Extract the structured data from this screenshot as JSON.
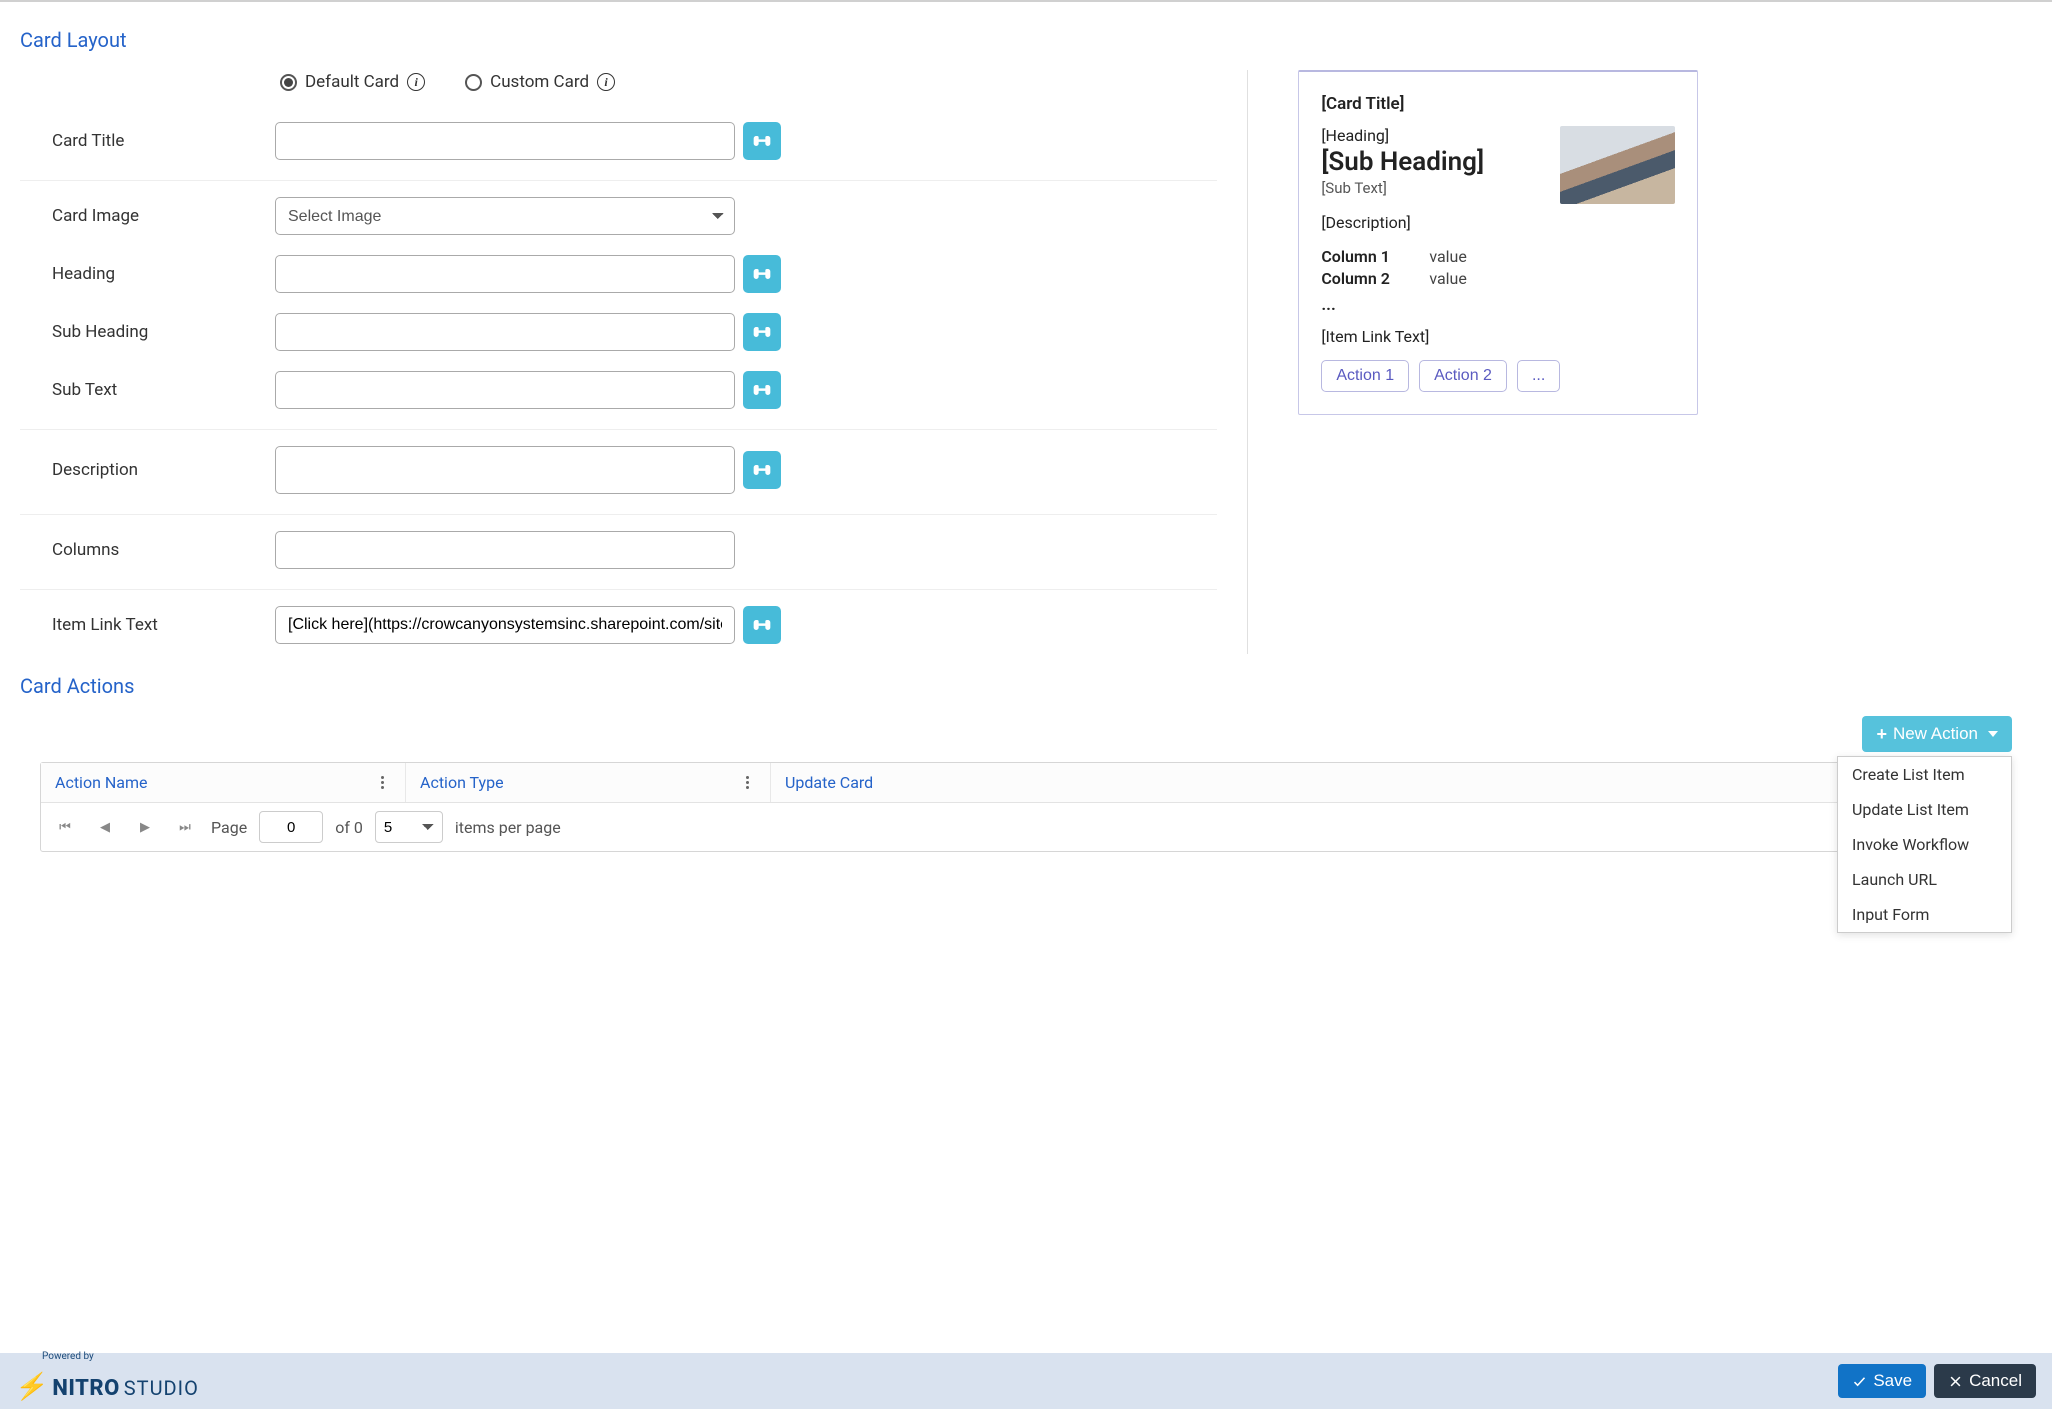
{
  "sections": {
    "card_layout": "Card Layout",
    "card_actions": "Card Actions"
  },
  "radio": {
    "default_card": "Default Card",
    "custom_card": "Custom Card"
  },
  "labels": {
    "card_title": "Card Title",
    "card_image": "Card Image",
    "heading": "Heading",
    "sub_heading": "Sub Heading",
    "sub_text": "Sub Text",
    "description": "Description",
    "columns": "Columns",
    "item_link_text": "Item Link Text"
  },
  "values": {
    "card_title": "",
    "card_image_placeholder": "Select Image",
    "heading": "",
    "sub_heading": "",
    "sub_text": "",
    "description": "",
    "columns": "",
    "item_link_text": "[Click here](https://crowcanyonsystemsinc.sharepoint.com/sites"
  },
  "preview": {
    "title": "[Card Title]",
    "heading": "[Heading]",
    "sub_heading": "[Sub Heading]",
    "sub_text": "[Sub Text]",
    "description": "[Description]",
    "col1_key": "Column 1",
    "col1_val": "value",
    "col2_key": "Column 2",
    "col2_val": "value",
    "ellipsis": "...",
    "link_text": "[Item Link Text]",
    "action1": "Action 1",
    "action2": "Action 2",
    "action_more": "..."
  },
  "actions": {
    "new_action": "New Action",
    "dropdown": [
      "Create List Item",
      "Update List Item",
      "Invoke Workflow",
      "Launch URL",
      "Input Form"
    ],
    "grid": {
      "col_action_name": "Action Name",
      "col_action_type": "Action Type",
      "col_update_card": "Update Card"
    },
    "pager": {
      "page_label": "Page",
      "page_value": "0",
      "of_label": "of 0",
      "page_size": "5",
      "items_per_page": "items per page"
    }
  },
  "footer": {
    "powered_by": "Powered by",
    "brand_name": "NITRO",
    "brand_studio": "STUDIO",
    "save": "Save",
    "cancel": "Cancel"
  }
}
